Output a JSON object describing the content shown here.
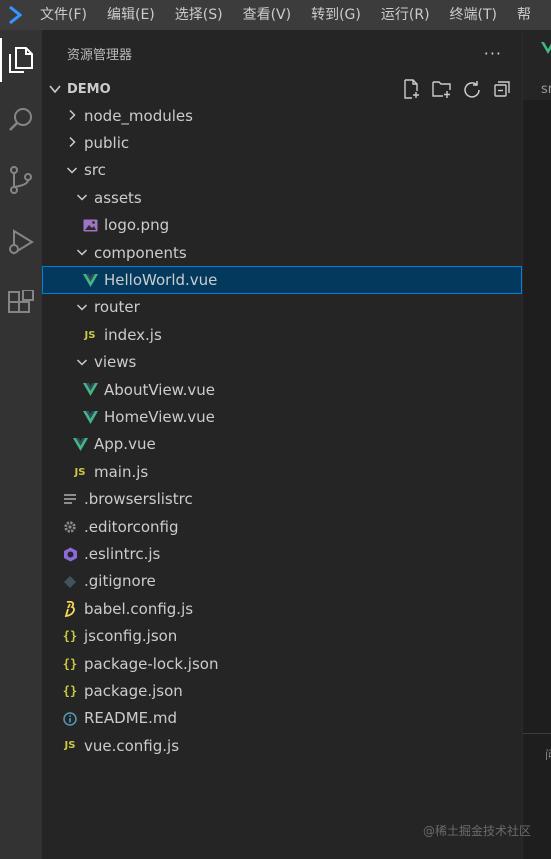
{
  "menu": [
    "文件(F)",
    "编辑(E)",
    "选择(S)",
    "查看(V)",
    "转到(G)",
    "运行(R)",
    "终端(T)",
    "帮"
  ],
  "sidebar": {
    "title": "资源管理器",
    "more": "···",
    "folder": "DEMO"
  },
  "tree": [
    {
      "label": "node_modules",
      "type": "folder",
      "state": "collapsed",
      "depth": 0
    },
    {
      "label": "public",
      "type": "folder",
      "state": "collapsed",
      "depth": 0
    },
    {
      "label": "src",
      "type": "folder",
      "state": "expanded",
      "depth": 0
    },
    {
      "label": "assets",
      "type": "folder",
      "state": "expanded",
      "depth": 1
    },
    {
      "label": "logo.png",
      "type": "image",
      "depth": 2
    },
    {
      "label": "components",
      "type": "folder",
      "state": "expanded",
      "depth": 1
    },
    {
      "label": "HelloWorld.vue",
      "type": "vue",
      "depth": 2,
      "selected": true
    },
    {
      "label": "router",
      "type": "folder",
      "state": "expanded",
      "depth": 1
    },
    {
      "label": "index.js",
      "type": "js",
      "depth": 2
    },
    {
      "label": "views",
      "type": "folder",
      "state": "expanded",
      "depth": 1
    },
    {
      "label": "AboutView.vue",
      "type": "vue",
      "depth": 2
    },
    {
      "label": "HomeView.vue",
      "type": "vue",
      "depth": 2
    },
    {
      "label": "App.vue",
      "type": "vue",
      "depth": 1
    },
    {
      "label": "main.js",
      "type": "js",
      "depth": 1
    },
    {
      "label": ".browserslistrc",
      "type": "lines",
      "depth": 0
    },
    {
      "label": ".editorconfig",
      "type": "gear",
      "depth": 0
    },
    {
      "label": ".eslintrc.js",
      "type": "eslint",
      "depth": 0
    },
    {
      "label": ".gitignore",
      "type": "git",
      "depth": 0
    },
    {
      "label": "babel.config.js",
      "type": "babel",
      "depth": 0
    },
    {
      "label": "jsconfig.json",
      "type": "json",
      "depth": 0
    },
    {
      "label": "package-lock.json",
      "type": "json",
      "depth": 0
    },
    {
      "label": "package.json",
      "type": "json",
      "depth": 0
    },
    {
      "label": "README.md",
      "type": "info",
      "depth": 0
    },
    {
      "label": "vue.config.js",
      "type": "js",
      "depth": 0
    }
  ],
  "editor": {
    "tab_fragment": "sr",
    "panel_fragment": "问"
  },
  "watermark": "@稀土掘金技术社区",
  "colors": {
    "vue": "#41b883",
    "js": "#cbcb41",
    "selection": "#04395e",
    "selection_border": "#007fd4"
  }
}
